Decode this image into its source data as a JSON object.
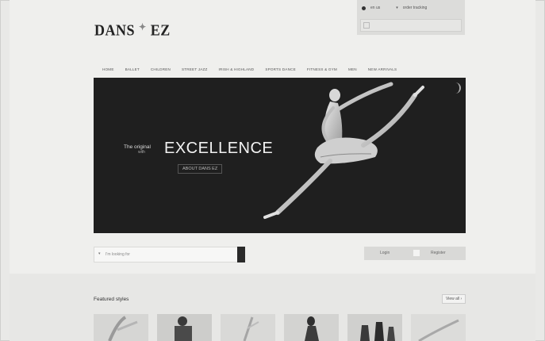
{
  "logo": {
    "text": "DANS",
    "text2": "EZ"
  },
  "utility": {
    "lang": "en us",
    "account": "order tracking"
  },
  "nav": [
    "Home",
    "Ballet",
    "Children",
    "Street Jazz",
    "Irish & Highland",
    "Sports Dance",
    "Fitness & Gym",
    "Men",
    "New Arrivals"
  ],
  "hero": {
    "tagline": "The original",
    "tagline_sub": "with",
    "title": "EXCELLENCE",
    "cta": "ABOUT DANS EZ"
  },
  "search": {
    "select_text": "I'm looking for"
  },
  "login": {
    "login_label": "Login",
    "register_label": "Register"
  },
  "featured": {
    "title": "Featured styles",
    "view_all": "View all"
  },
  "colors": {
    "hero_bg": "#1f1f1f",
    "page_bg": "#efefed",
    "accent": "#2a2a2a"
  }
}
